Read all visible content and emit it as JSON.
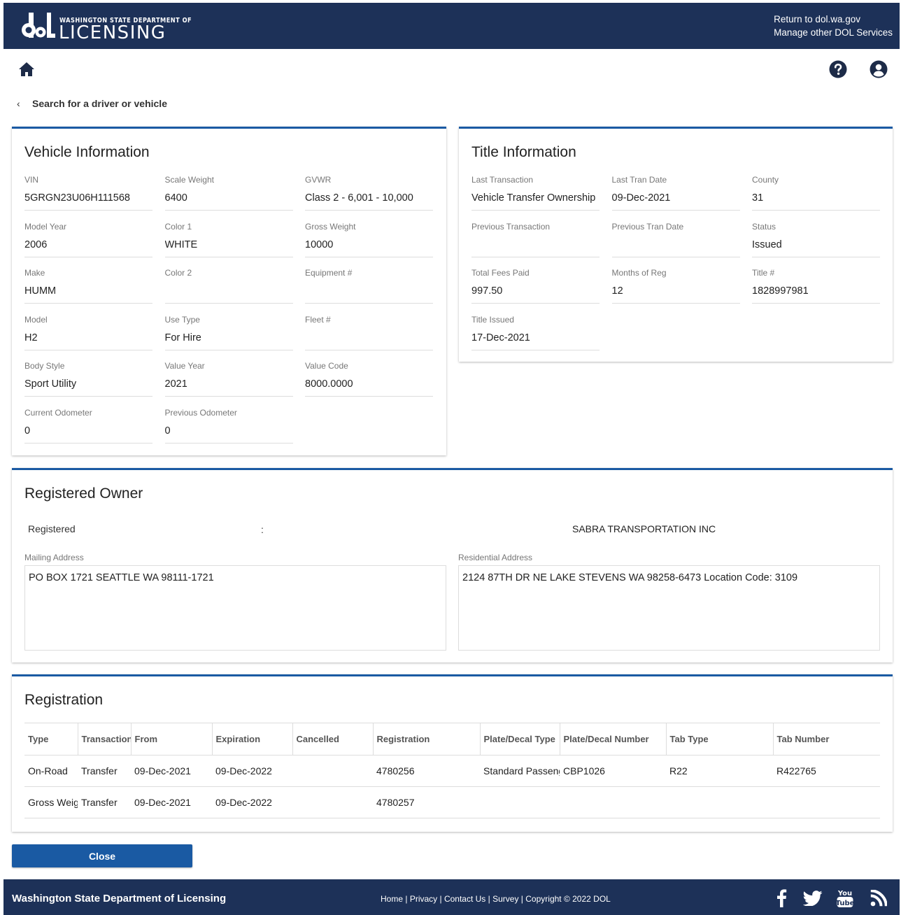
{
  "header": {
    "logo_small": "WASHINGTON STATE DEPARTMENT OF",
    "logo_big": "LICENSING",
    "links": [
      "Return to dol.wa.gov",
      "Manage other DOL Services"
    ]
  },
  "nav": {
    "back_label": "Search for a driver or vehicle"
  },
  "vehicle": {
    "title": "Vehicle Information",
    "fields": [
      {
        "label": "VIN",
        "value": "5GRGN23U06H111568"
      },
      {
        "label": "Scale Weight",
        "value": "6400"
      },
      {
        "label": "GVWR",
        "value": "Class 2 - 6,001 - 10,000"
      },
      {
        "label": "Model Year",
        "value": "2006"
      },
      {
        "label": "Color 1",
        "value": "WHITE"
      },
      {
        "label": "Gross Weight",
        "value": "10000"
      },
      {
        "label": "Make",
        "value": "HUMM"
      },
      {
        "label": "Color 2",
        "value": ""
      },
      {
        "label": "Equipment #",
        "value": ""
      },
      {
        "label": "Model",
        "value": "H2"
      },
      {
        "label": "Use Type",
        "value": "For Hire"
      },
      {
        "label": "Fleet #",
        "value": ""
      },
      {
        "label": "Body Style",
        "value": "Sport Utility"
      },
      {
        "label": "Value Year",
        "value": "2021"
      },
      {
        "label": "Value Code",
        "value": "8000.0000"
      },
      {
        "label": "Current Odometer",
        "value": "0"
      },
      {
        "label": "Previous Odometer",
        "value": "0"
      }
    ]
  },
  "title_info": {
    "title": "Title Information",
    "fields": [
      {
        "label": "Last Transaction",
        "value": "Vehicle Transfer Ownership"
      },
      {
        "label": "Last Tran Date",
        "value": "09-Dec-2021"
      },
      {
        "label": "County",
        "value": "31"
      },
      {
        "label": "Previous Transaction",
        "value": ""
      },
      {
        "label": "Previous Tran Date",
        "value": ""
      },
      {
        "label": "Status",
        "value": "Issued"
      },
      {
        "label": "Total Fees Paid",
        "value": "997.50"
      },
      {
        "label": "Months of Reg",
        "value": "12"
      },
      {
        "label": "Title #",
        "value": "1828997981"
      },
      {
        "label": "Title Issued",
        "value": "17-Dec-2021"
      }
    ]
  },
  "owner": {
    "title": "Registered Owner",
    "registered_label": "Registered",
    "colon": ":",
    "registered_name": "SABRA TRANSPORTATION INC",
    "mailing_label": "Mailing Address",
    "mailing_value": "PO BOX 1721 SEATTLE WA 98111-1721",
    "residential_label": "Residential Address",
    "residential_value": "2124 87TH DR NE LAKE STEVENS WA 98258-6473   Location Code: 3109"
  },
  "registration": {
    "title": "Registration",
    "columns": [
      "Type",
      "Transaction",
      "From",
      "Expiration",
      "Cancelled",
      "Registration",
      "Plate/Decal Type",
      "Plate/Decal Number",
      "Tab Type",
      "Tab Number"
    ],
    "rows": [
      [
        "On-Road",
        "Transfer",
        "09-Dec-2021",
        "09-Dec-2022",
        "",
        "4780256",
        "Standard Passenger",
        "CBP1026",
        "R22",
        "R422765"
      ],
      [
        "Gross Weight",
        "Transfer",
        "09-Dec-2021",
        "09-Dec-2022",
        "",
        "4780257",
        "",
        "",
        "",
        ""
      ]
    ]
  },
  "actions": {
    "close_label": "Close"
  },
  "footer": {
    "title": "Washington State Department of Licensing",
    "links": [
      "Home",
      "Privacy",
      "Contact Us",
      "Survey",
      "Copyright © 2022 DOL"
    ]
  },
  "colors": {
    "navy": "#1d3158",
    "accent_blue": "#1a5aa3"
  },
  "icons": [
    "home-icon",
    "help-icon",
    "account-icon",
    "chevron-left-icon",
    "facebook-icon",
    "twitter-icon",
    "youtube-icon",
    "rss-icon"
  ]
}
